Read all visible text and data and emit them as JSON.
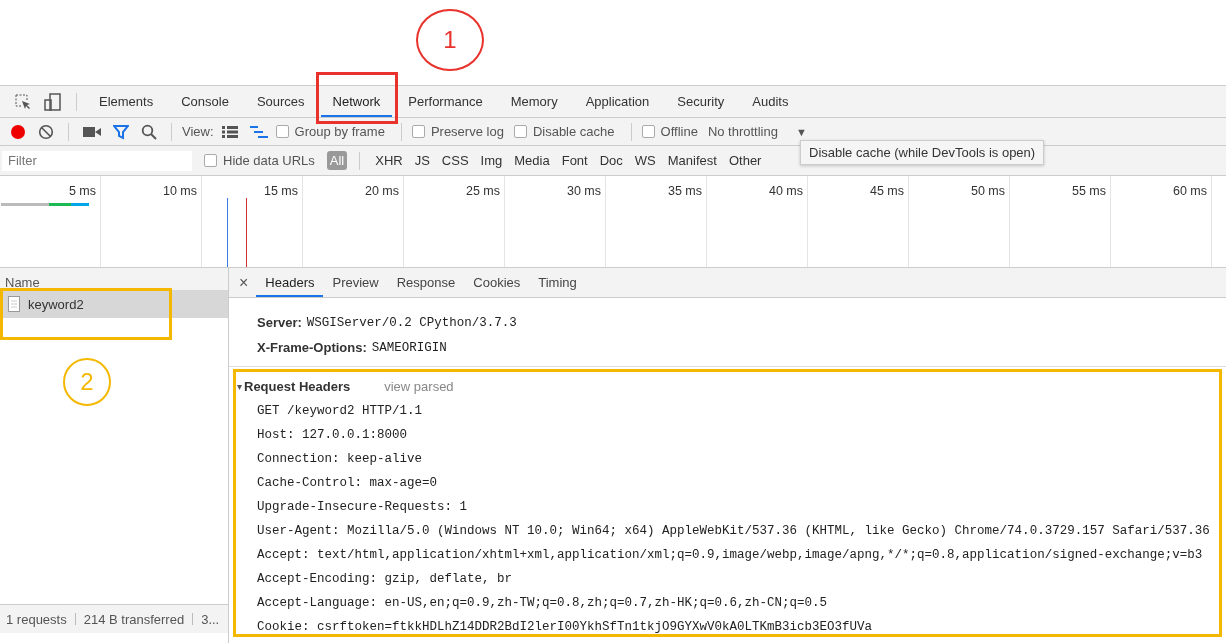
{
  "annotations": [
    {
      "kind": "circle",
      "label": "1",
      "color": "#e8322b"
    },
    {
      "kind": "box",
      "color": "#e8322b"
    },
    {
      "kind": "box",
      "color": "#f5b800"
    },
    {
      "kind": "circle",
      "label": "2",
      "color": "#f5b800"
    },
    {
      "kind": "box",
      "color": "#f5b800"
    }
  ],
  "panel_tabs": [
    {
      "label": "Elements",
      "selected": false
    },
    {
      "label": "Console",
      "selected": false
    },
    {
      "label": "Sources",
      "selected": false
    },
    {
      "label": "Network",
      "selected": true
    },
    {
      "label": "Performance",
      "selected": false
    },
    {
      "label": "Memory",
      "selected": false
    },
    {
      "label": "Application",
      "selected": false
    },
    {
      "label": "Security",
      "selected": false
    },
    {
      "label": "Audits",
      "selected": false
    }
  ],
  "network_toolbar": {
    "recording": true,
    "filter_on": true,
    "view_label": "View:",
    "large_rows": false,
    "overview": true,
    "checkboxes": [
      {
        "label": "Group by frame",
        "checked": false
      },
      {
        "label": "Preserve log",
        "checked": false
      },
      {
        "label": "Disable cache",
        "checked": false
      },
      {
        "label": "Offline",
        "checked": false
      }
    ],
    "throttling": "No throttling",
    "dropdown": "▼"
  },
  "tooltip": "Disable cache (while DevTools is open)",
  "filter_bar": {
    "placeholder": "Filter",
    "hide_data_urls": {
      "label": "Hide data URLs",
      "checked": false
    },
    "types": [
      {
        "label": "All",
        "selected": true
      },
      {
        "label": "XHR",
        "selected": false
      },
      {
        "label": "JS",
        "selected": false
      },
      {
        "label": "CSS",
        "selected": false
      },
      {
        "label": "Img",
        "selected": false
      },
      {
        "label": "Media",
        "selected": false
      },
      {
        "label": "Font",
        "selected": false
      },
      {
        "label": "Doc",
        "selected": false
      },
      {
        "label": "WS",
        "selected": false
      },
      {
        "label": "Manifest",
        "selected": false
      },
      {
        "label": "Other",
        "selected": false
      }
    ]
  },
  "timeline": {
    "ticks": [
      "5 ms",
      "10 ms",
      "15 ms",
      "20 ms",
      "25 ms",
      "30 ms",
      "35 ms",
      "40 ms",
      "45 ms",
      "50 ms",
      "55 ms",
      "60 ms"
    ]
  },
  "requests": {
    "column": "Name",
    "rows": [
      {
        "name": "keyword2",
        "selected": true
      }
    ]
  },
  "detail_tabs": {
    "close": "×",
    "tabs": [
      {
        "label": "Headers",
        "selected": true
      },
      {
        "label": "Preview",
        "selected": false
      },
      {
        "label": "Response",
        "selected": false
      },
      {
        "label": "Cookies",
        "selected": false
      },
      {
        "label": "Timing",
        "selected": false
      }
    ]
  },
  "response_headers": [
    {
      "name": "Server:",
      "value": "WSGIServer/0.2 CPython/3.7.3"
    },
    {
      "name": "X-Frame-Options:",
      "value": "SAMEORIGIN"
    }
  ],
  "request_headers": {
    "toggle": "▾",
    "title": "Request Headers",
    "expanded": true,
    "link": "view parsed",
    "lines": [
      "GET /keyword2 HTTP/1.1",
      "Host: 127.0.0.1:8000",
      "Connection: keep-alive",
      "Cache-Control: max-age=0",
      "Upgrade-Insecure-Requests: 1",
      "User-Agent: Mozilla/5.0 (Windows NT 10.0; Win64; x64) AppleWebKit/537.36 (KHTML, like Gecko) Chrome/74.0.3729.157 Safari/537.36",
      "Accept: text/html,application/xhtml+xml,application/xml;q=0.9,image/webp,image/apng,*/*;q=0.8,application/signed-exchange;v=b3",
      "Accept-Encoding: gzip, deflate, br",
      "Accept-Language: en-US,en;q=0.9,zh-TW;q=0.8,zh;q=0.7,zh-HK;q=0.6,zh-CN;q=0.5",
      "Cookie: csrftoken=ftkkHDLhZ14DDR2BdI2lerI00YkhSfTn1tkjO9GYXwV0kA0LTKmB3icb3EO3fUVa"
    ]
  },
  "status_bar": [
    "1 requests",
    "214 B transferred",
    "3..."
  ]
}
